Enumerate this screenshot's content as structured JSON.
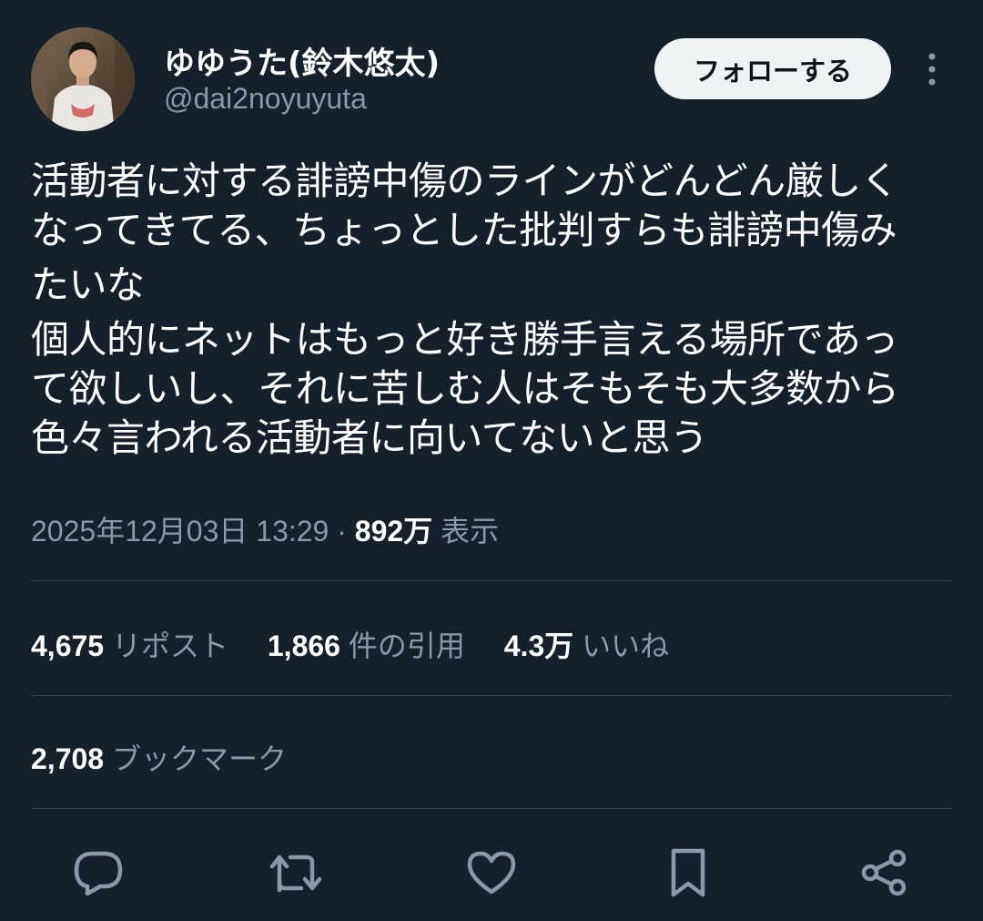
{
  "user": {
    "display_name": "ゆゆうた(鈴木悠太)",
    "handle": "@dai2noyuyuta",
    "follow_label": "フォローする"
  },
  "tweet": {
    "lines": [
      "活動者に対する誹謗中傷のラインがどんどん厳しく",
      "なってきてる、ちょっとした批判すらも誹謗中傷み",
      "たいな",
      "個人的にネットはもっと好き勝手言える場所であっ",
      "て欲しいし、それに苦しむ人はそもそも大多数から",
      "色々言われる活動者に向いてないと思う"
    ]
  },
  "meta": {
    "timestamp": "2025年12月03日 13:29",
    "separator": "·",
    "views_count": "892万",
    "views_label": "表示"
  },
  "stats": {
    "reposts": {
      "count": "4,675",
      "label": "リポスト"
    },
    "quotes": {
      "count": "1,866",
      "label": "件の引用"
    },
    "likes": {
      "count": "4.3万",
      "label": "いいね"
    },
    "bookmarks": {
      "count": "2,708",
      "label": "ブックマーク"
    }
  },
  "actions": [
    {
      "icon": "reply-icon"
    },
    {
      "icon": "repost-icon"
    },
    {
      "icon": "like-icon"
    },
    {
      "icon": "bookmark-icon"
    },
    {
      "icon": "share-icon"
    }
  ],
  "colors": {
    "background": "#15202b",
    "text_primary": "#ffffff",
    "text_secondary": "#8b98a5",
    "divider": "#38444d",
    "button_bg": "#eff3f4"
  }
}
